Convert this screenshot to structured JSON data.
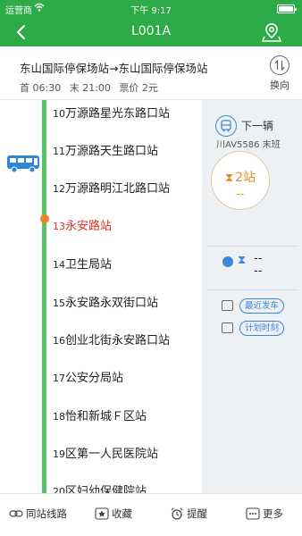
{
  "status_bar": {
    "carrier": "运营商",
    "time": "下午 9:17"
  },
  "nav": {
    "title": "L001A",
    "back_icon": "chevron-left-icon",
    "map_icon": "map-pin-icon"
  },
  "route": {
    "name": "东山国际停保场站→东山国际停保场站",
    "first": "首 06:30",
    "last": "末 21:00",
    "fare": "票价 2元",
    "switch_label": "换向",
    "switch_icon": "swap-direction-icon"
  },
  "stations": [
    {
      "num": "10",
      "name": "万源路星光东路口站",
      "current": false
    },
    {
      "num": "11",
      "name": "万源路天生路口站",
      "current": false
    },
    {
      "num": "12",
      "name": "万源路明江北路口站",
      "current": false
    },
    {
      "num": "13",
      "name": "永安路站",
      "current": true
    },
    {
      "num": "14",
      "name": "卫生局站",
      "current": false
    },
    {
      "num": "15",
      "name": "永安路永双街口站",
      "current": false
    },
    {
      "num": "16",
      "name": "创业北街永安路口站",
      "current": false
    },
    {
      "num": "17",
      "name": "公安分局站",
      "current": false
    },
    {
      "num": "18",
      "name": "怡和新城Ｆ区站",
      "current": false
    },
    {
      "num": "19",
      "name": "区第一人民医院站",
      "current": false
    },
    {
      "num": "20",
      "name": "区妇幼保健院站",
      "current": false
    }
  ],
  "panel": {
    "next_label": "下一辆",
    "plate": "川AV5586 末班",
    "stops_away": "2站",
    "eta": "--",
    "second_eta_1": "--",
    "second_eta_2": "--",
    "recent_departure": "最近发车",
    "timetable": "计划时刻"
  },
  "tabs": [
    {
      "label": "同站线路",
      "icon": "link-icon"
    },
    {
      "label": "收藏",
      "icon": "star-icon"
    },
    {
      "label": "提醒",
      "icon": "alarm-clock-icon"
    },
    {
      "label": "更多",
      "icon": "more-icon"
    }
  ],
  "colors": {
    "primary": "#2dab48",
    "track": "#58c46a",
    "current": "#e0311f",
    "accent_blue": "#3b87d9",
    "accent_orange": "#e38c20"
  }
}
